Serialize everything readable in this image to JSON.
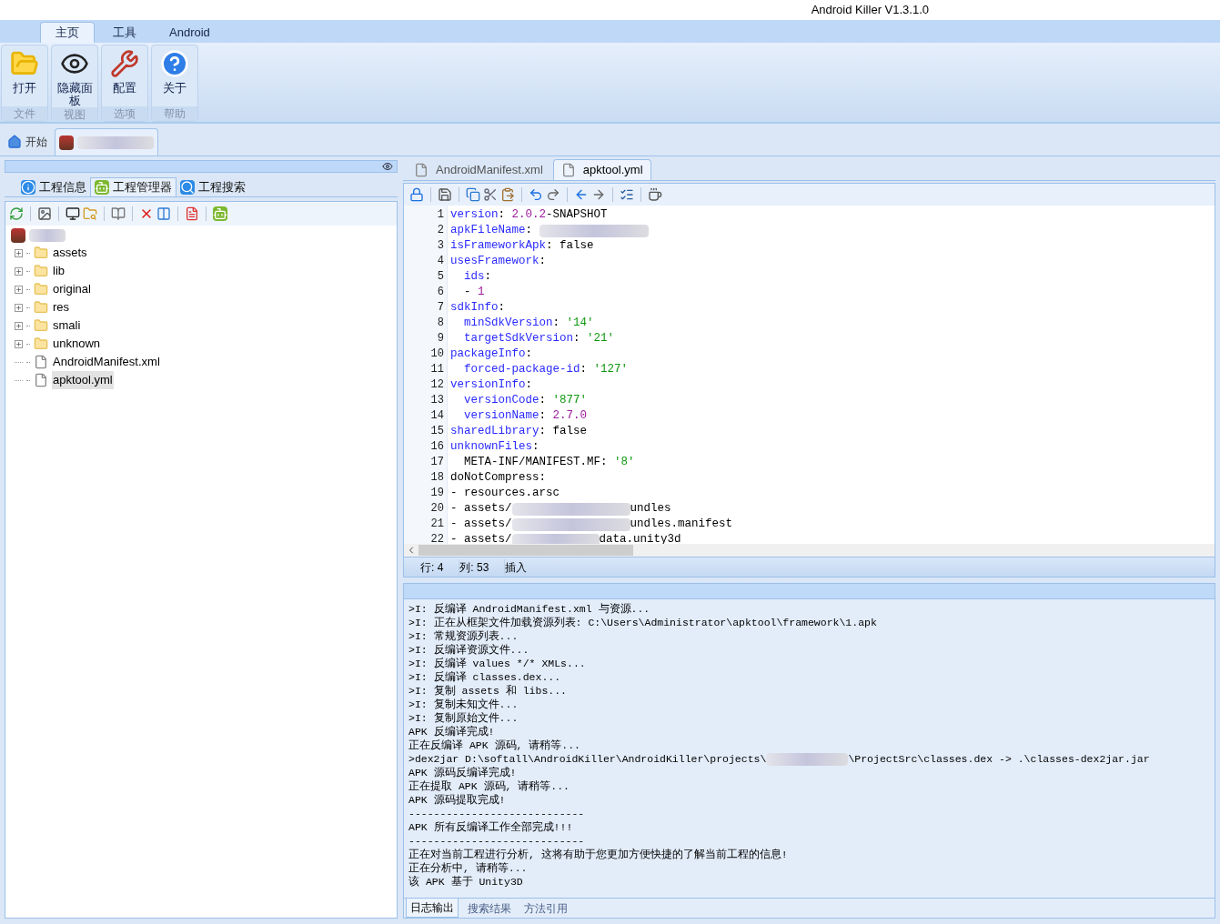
{
  "window": {
    "title": "Android Killer V1.3.1.0"
  },
  "ribbon_tabs": [
    {
      "label": "主页",
      "selected": true
    },
    {
      "label": "工具",
      "selected": false
    },
    {
      "label": "Android",
      "selected": false
    }
  ],
  "ribbon_groups": [
    {
      "label": "文件",
      "buttons": [
        {
          "label": "打开",
          "kind": "open"
        }
      ]
    },
    {
      "label": "视图",
      "buttons": [
        {
          "label": "隐藏面板",
          "kind": "eye"
        }
      ]
    },
    {
      "label": "选项",
      "buttons": [
        {
          "label": "配置",
          "kind": "tools"
        }
      ]
    },
    {
      "label": "帮助",
      "buttons": [
        {
          "label": "关于",
          "kind": "help"
        }
      ]
    }
  ],
  "doc_tabs": [
    {
      "kind": "home",
      "label": "开始",
      "selected": false
    },
    {
      "kind": "project",
      "selected": true
    }
  ],
  "left_panel": {
    "tabs": [
      {
        "label": "工程信息",
        "kind": "info",
        "selected": false
      },
      {
        "label": "工程管理器",
        "kind": "android",
        "selected": true
      },
      {
        "label": "工程搜索",
        "kind": "search",
        "selected": false
      }
    ],
    "tree": {
      "children": [
        {
          "label": "assets",
          "kind": "folder",
          "expanded": false,
          "selected": false
        },
        {
          "label": "lib",
          "kind": "folder",
          "expanded": false,
          "selected": false
        },
        {
          "label": "original",
          "kind": "folder",
          "expanded": false,
          "selected": false
        },
        {
          "label": "res",
          "kind": "folder",
          "expanded": false,
          "selected": false
        },
        {
          "label": "smali",
          "kind": "folder",
          "expanded": false,
          "selected": false
        },
        {
          "label": "unknown",
          "kind": "folder",
          "expanded": false,
          "selected": false
        },
        {
          "label": "AndroidManifest.xml",
          "kind": "file",
          "selected": false
        },
        {
          "label": "apktool.yml",
          "kind": "file",
          "selected": true
        }
      ]
    }
  },
  "editor": {
    "tabs": [
      {
        "label": "AndroidManifest.xml",
        "selected": false
      },
      {
        "label": "apktool.yml",
        "selected": true
      }
    ],
    "lines": [
      {
        "num": "1",
        "tokens": [
          {
            "kind": "key",
            "text": "version"
          },
          {
            "kind": "plain",
            "text": ": "
          },
          {
            "kind": "number",
            "text": "2.0.2"
          },
          {
            "kind": "plain",
            "text": "-SNAPSHOT"
          }
        ]
      },
      {
        "num": "2",
        "tokens": [
          {
            "kind": "key",
            "text": "apkFileName"
          },
          {
            "kind": "plain",
            "text": ": "
          },
          {
            "kind": "redacted"
          }
        ]
      },
      {
        "num": "3",
        "tokens": [
          {
            "kind": "key",
            "text": "isFrameworkApk"
          },
          {
            "kind": "plain",
            "text": ": false"
          }
        ]
      },
      {
        "num": "4",
        "tokens": [
          {
            "kind": "key",
            "text": "usesFramework"
          },
          {
            "kind": "plain",
            "text": ":"
          }
        ]
      },
      {
        "num": "5",
        "tokens": [
          {
            "kind": "key",
            "text": "  ids"
          },
          {
            "kind": "plain",
            "text": ":"
          }
        ]
      },
      {
        "num": "6",
        "tokens": [
          {
            "kind": "plain",
            "text": "  - "
          },
          {
            "kind": "number",
            "text": "1"
          }
        ]
      },
      {
        "num": "7",
        "tokens": [
          {
            "kind": "key",
            "text": "sdkInfo"
          },
          {
            "kind": "plain",
            "text": ":"
          }
        ]
      },
      {
        "num": "8",
        "tokens": [
          {
            "kind": "key",
            "text": "  minSdkVersion"
          },
          {
            "kind": "plain",
            "text": ": "
          },
          {
            "kind": "string",
            "text": "'14'"
          }
        ]
      },
      {
        "num": "9",
        "tokens": [
          {
            "kind": "key",
            "text": "  targetSdkVersion"
          },
          {
            "kind": "plain",
            "text": ": "
          },
          {
            "kind": "string",
            "text": "'21'"
          }
        ]
      },
      {
        "num": "10",
        "tokens": [
          {
            "kind": "key",
            "text": "packageInfo"
          },
          {
            "kind": "plain",
            "text": ":"
          }
        ]
      },
      {
        "num": "11",
        "tokens": [
          {
            "kind": "key",
            "text": "  forced-package-id"
          },
          {
            "kind": "plain",
            "text": ": "
          },
          {
            "kind": "string",
            "text": "'127'"
          }
        ]
      },
      {
        "num": "12",
        "tokens": [
          {
            "kind": "key",
            "text": "versionInfo"
          },
          {
            "kind": "plain",
            "text": ":"
          }
        ]
      },
      {
        "num": "13",
        "tokens": [
          {
            "kind": "key",
            "text": "  versionCode"
          },
          {
            "kind": "plain",
            "text": ": "
          },
          {
            "kind": "string",
            "text": "'877'"
          }
        ]
      },
      {
        "num": "14",
        "tokens": [
          {
            "kind": "key",
            "text": "  versionName"
          },
          {
            "kind": "plain",
            "text": ": "
          },
          {
            "kind": "number",
            "text": "2.7.0"
          }
        ]
      },
      {
        "num": "15",
        "tokens": [
          {
            "kind": "key",
            "text": "sharedLibrary"
          },
          {
            "kind": "plain",
            "text": ": false"
          }
        ]
      },
      {
        "num": "16",
        "tokens": [
          {
            "kind": "key",
            "text": "unknownFiles"
          },
          {
            "kind": "plain",
            "text": ":"
          }
        ]
      },
      {
        "num": "17",
        "tokens": [
          {
            "kind": "plain",
            "text": "  META-INF/MANIFEST.MF: "
          },
          {
            "kind": "string",
            "text": "'8'"
          }
        ]
      },
      {
        "num": "18",
        "tokens": [
          {
            "kind": "plain",
            "text": "doNotCompress:"
          }
        ]
      },
      {
        "num": "19",
        "tokens": [
          {
            "kind": "plain",
            "text": "- resources.arsc"
          }
        ]
      },
      {
        "num": "20",
        "tokens": [
          {
            "kind": "plain",
            "text": "- assets/"
          },
          {
            "kind": "redacted"
          },
          {
            "kind": "plain",
            "text": "undles"
          }
        ]
      },
      {
        "num": "21",
        "tokens": [
          {
            "kind": "plain",
            "text": "- assets/"
          },
          {
            "kind": "redacted"
          },
          {
            "kind": "plain",
            "text": "undles.manifest"
          }
        ]
      },
      {
        "num": "22",
        "tokens": [
          {
            "kind": "plain",
            "text": "- assets/"
          },
          {
            "kind": "redacted"
          },
          {
            "kind": "plain",
            "text": "data.unity3d"
          }
        ]
      }
    ],
    "status": [
      {
        "label": "行: 4"
      },
      {
        "label": "列: 53"
      },
      {
        "label": "插入"
      }
    ]
  },
  "log": {
    "lines": [
      [
        {
          "kind": "plain",
          "text": ">I: 反编译 AndroidManifest.xml 与资源..."
        }
      ],
      [
        {
          "kind": "plain",
          "text": ">I: 正在从框架文件加载资源列表: C:\\Users\\Administrator\\apktool\\framework\\1.apk"
        }
      ],
      [
        {
          "kind": "plain",
          "text": ">I: 常规资源列表..."
        }
      ],
      [
        {
          "kind": "plain",
          "text": ">I: 反编译资源文件..."
        }
      ],
      [
        {
          "kind": "plain",
          "text": ">I: 反编译 values */* XMLs..."
        }
      ],
      [
        {
          "kind": "plain",
          "text": ">I: 反编译 classes.dex..."
        }
      ],
      [
        {
          "kind": "plain",
          "text": ">I: 复制 assets 和 libs..."
        }
      ],
      [
        {
          "kind": "plain",
          "text": ">I: 复制未知文件..."
        }
      ],
      [
        {
          "kind": "plain",
          "text": ">I: 复制原始文件..."
        }
      ],
      [
        {
          "kind": "plain",
          "text": "APK 反编译完成!"
        }
      ],
      [
        {
          "kind": "plain",
          "text": "正在反编译 APK 源码, 请稍等..."
        }
      ],
      [
        {
          "kind": "plain",
          "text": ">dex2jar D:\\softall\\AndroidKiller\\AndroidKiller\\projects\\"
        },
        {
          "kind": "redacted"
        },
        {
          "kind": "plain",
          "text": "\\ProjectSrc\\classes.dex -> .\\classes-dex2jar.jar"
        }
      ],
      [
        {
          "kind": "plain",
          "text": "APK 源码反编译完成!"
        }
      ],
      [
        {
          "kind": "plain",
          "text": "正在提取 APK 源码, 请稍等..."
        }
      ],
      [
        {
          "kind": "plain",
          "text": "APK 源码提取完成!"
        }
      ],
      [
        {
          "kind": "plain",
          "text": "----------------------------"
        }
      ],
      [
        {
          "kind": "plain",
          "text": "APK 所有反编译工作全部完成!!!"
        }
      ],
      [
        {
          "kind": "plain",
          "text": "----------------------------"
        }
      ],
      [
        {
          "kind": "plain",
          "text": "正在对当前工程进行分析, 这将有助于您更加方便快捷的了解当前工程的信息!"
        }
      ],
      [
        {
          "kind": "plain",
          "text": "正在分析中, 请稍等..."
        }
      ],
      [
        {
          "kind": "plain",
          "text": "该 APK 基于 Unity3D"
        }
      ]
    ],
    "tabs": [
      {
        "label": "日志输出",
        "selected": true
      },
      {
        "label": "搜索结果",
        "selected": false
      },
      {
        "label": "方法引用",
        "selected": false
      }
    ]
  }
}
